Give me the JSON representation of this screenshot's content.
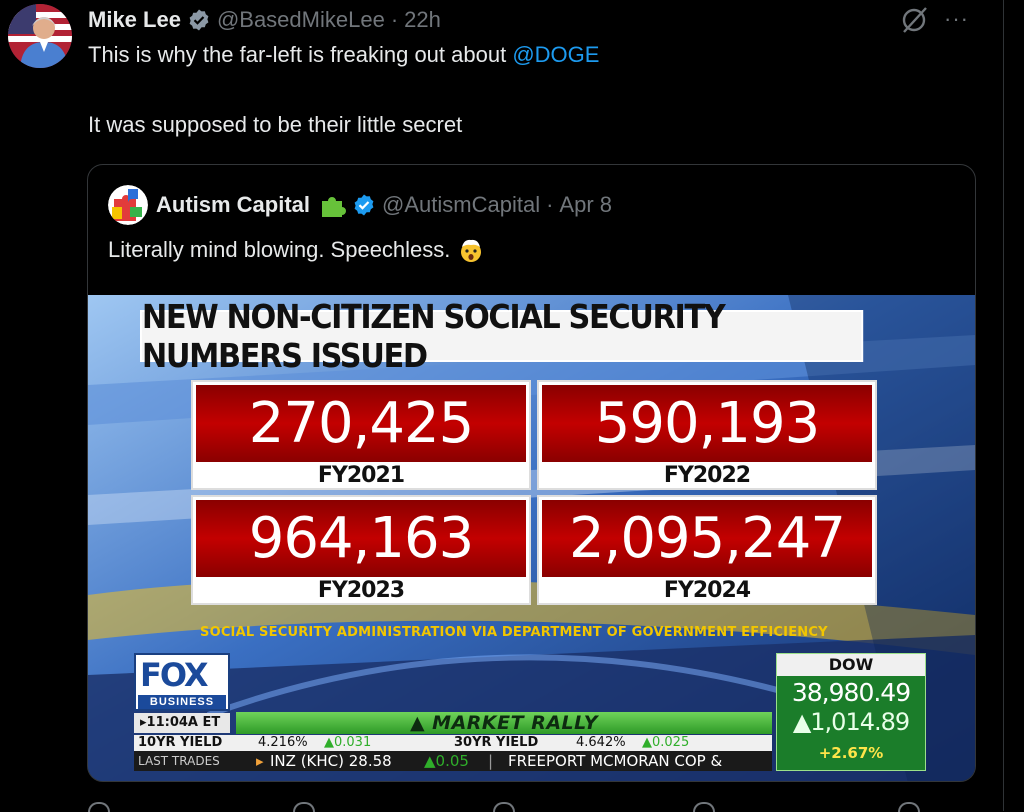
{
  "tweet": {
    "author_name": "Mike Lee",
    "handle": "@BasedMikeLee",
    "separator": "·",
    "time": "22h",
    "line1_prefix": "This is why the far-left is freaking out about ",
    "line1_mention": "@DOGE",
    "line2": "It was supposed to be their little secret",
    "more_label": "···"
  },
  "quote": {
    "author_name": "Autism Capital",
    "handle": "@AutismCapital",
    "separator": "·",
    "date": "Apr 8",
    "text": "Literally mind blowing. Speechless.",
    "media": {
      "banner": "NEW NON-CITIZEN SOCIAL SECURITY NUMBERS ISSUED",
      "cells": [
        {
          "value": "270,425",
          "year": "FY2021"
        },
        {
          "value": "590,193",
          "year": "FY2022"
        },
        {
          "value": "964,163",
          "year": "FY2023"
        },
        {
          "value": "2,095,247",
          "year": "FY2024"
        }
      ],
      "source": "SOCIAL SECURITY ADMINISTRATION VIA DEPARTMENT OF GOVERNMENT EFFICIENCY",
      "network_logo": "FOX",
      "network_sub": "BUSINESS",
      "clock": "▸11:04A ET",
      "headline": "▲ MARKET RALLY",
      "ticker_top": {
        "a_label": "10YR YIELD",
        "a_value": "4.216%",
        "a_change": "▲0.031",
        "b_label": "30YR YIELD",
        "b_value": "4.642%",
        "b_change": "▲0.025"
      },
      "ticker_bottom": {
        "label": "LAST TRADES",
        "arrow": "▸",
        "item": "INZ (KHC) 28.58",
        "change": "▲0.05",
        "divider": "|",
        "next": "FREEPORT MCMORAN COP &"
      },
      "dow": {
        "label": "DOW",
        "value": "38,980.49",
        "change": "▲1,014.89",
        "percent": "+2.67%"
      }
    }
  },
  "colors": {
    "background": "#000000",
    "text": "#e7e9ea",
    "muted": "#71767b",
    "link": "#1d9bf0",
    "verified": "#1d9bf0",
    "fox_red": "#c30000",
    "market_green": "#2e9a27"
  },
  "icons": [
    "verified-badge-icon",
    "grok-icon",
    "more-icon",
    "puzzle-piece-icon",
    "exploding-head-emoji"
  ]
}
